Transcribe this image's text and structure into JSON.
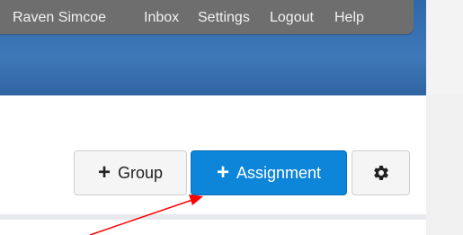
{
  "topnav": {
    "user": "Raven Simcoe",
    "inbox": "Inbox",
    "settings": "Settings",
    "logout": "Logout",
    "help": "Help"
  },
  "toolbar": {
    "group_label": "Group",
    "assignment_label": "Assignment",
    "plus_symbol": "+",
    "settings_icon": "gear-icon"
  },
  "colors": {
    "accent": "#0d85d8",
    "header": "#2f68a8",
    "topnav": "#6e6e6e",
    "annotation": "#ff0000"
  }
}
